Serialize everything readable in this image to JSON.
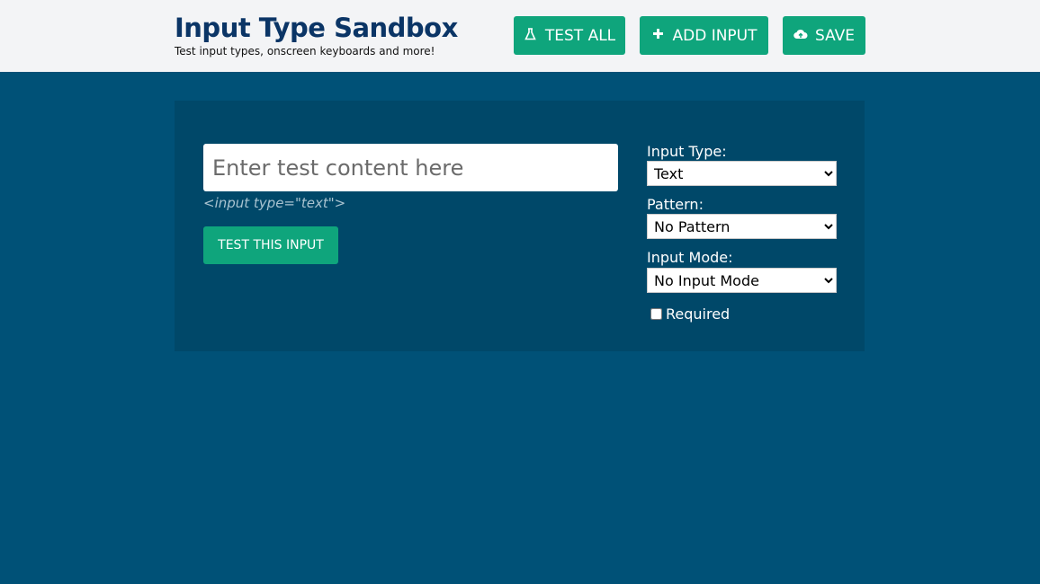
{
  "header": {
    "title": "Input Type Sandbox",
    "subtitle": "Test input types, onscreen keyboards and more!",
    "buttons": {
      "test_all": {
        "label": "TEST ALL",
        "icon": "flask-icon"
      },
      "add_input": {
        "label": "ADD INPUT",
        "icon": "plus-icon"
      },
      "save": {
        "label": "SAVE",
        "icon": "cloud-upload-icon"
      }
    }
  },
  "colors": {
    "accent": "#0fa57c",
    "background": "#005177",
    "panel": "#004869",
    "title": "#0b3566"
  },
  "panel": {
    "input": {
      "placeholder": "Enter test content here",
      "value": ""
    },
    "code_hint": "<input type=\"text\">",
    "test_button": "TEST THIS INPUT",
    "input_type": {
      "label": "Input Type:",
      "selected": "Text"
    },
    "pattern": {
      "label": "Pattern:",
      "selected": "No Pattern"
    },
    "input_mode": {
      "label": "Input Mode:",
      "selected": "No Input Mode"
    },
    "required": {
      "label": "Required",
      "checked": false
    }
  }
}
